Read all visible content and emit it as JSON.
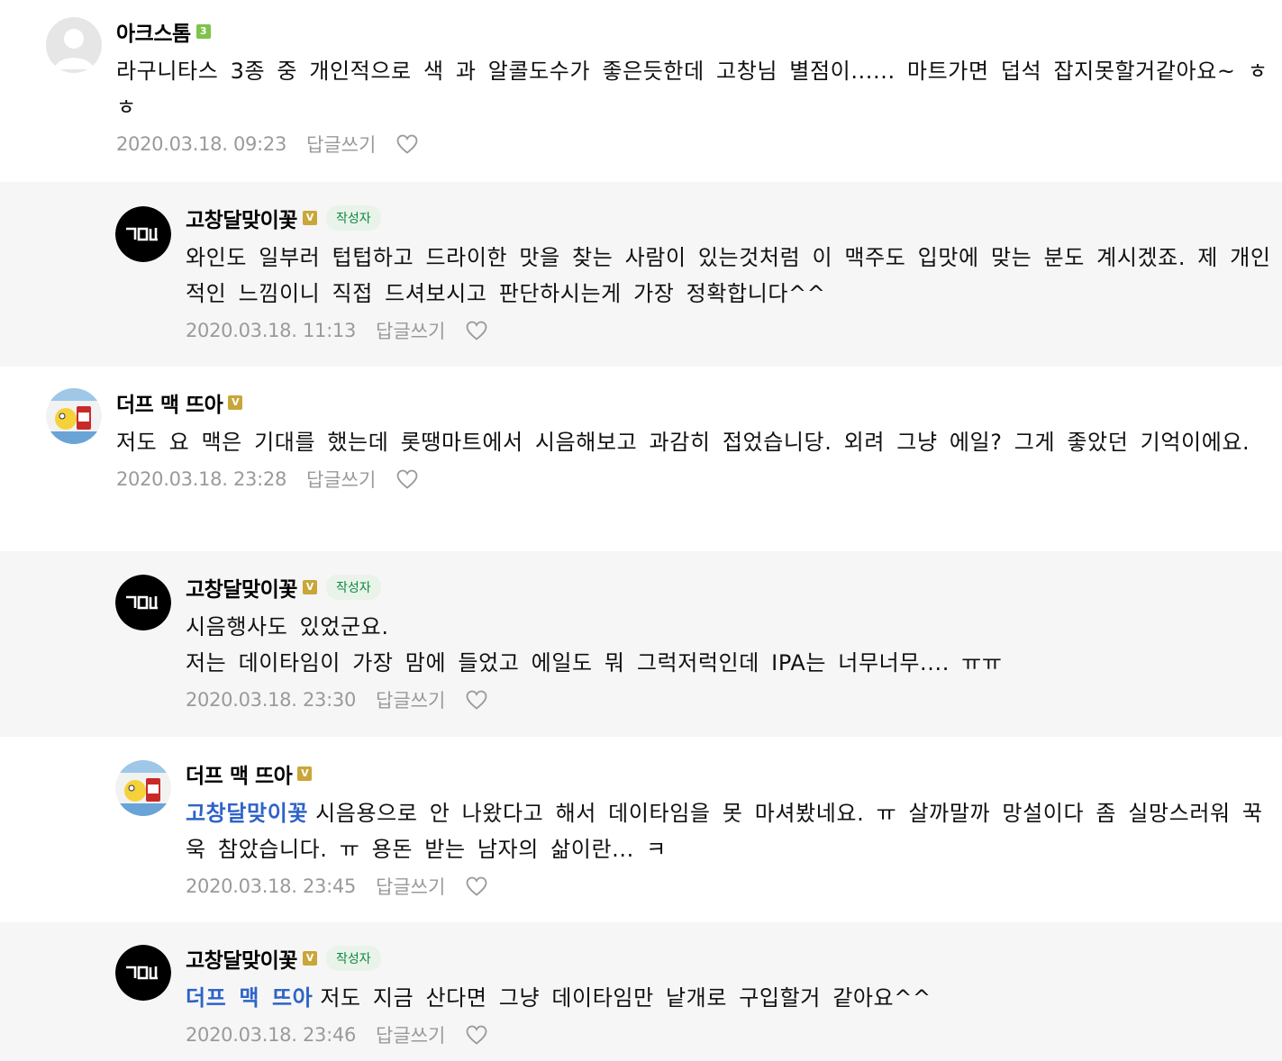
{
  "ui": {
    "reply_label": "답글쓰기",
    "author_tag": "작성자"
  },
  "comments": [
    {
      "type": "comment",
      "nickname": "아크스톰",
      "badge": "3",
      "avatar": "default-avatar",
      "text": "라구니타스 3종 중 개인적으로 색 과 알콜도수가 좋은듯한데 고창님 별점이...... 마트가면 덥석 잡지못할거같아요~ ㅎㅎ",
      "date": "2020.03.18. 09:23"
    },
    {
      "type": "reply",
      "nickname": "고창달맞이꽃",
      "badge": "V",
      "is_author": true,
      "avatar": "gdl-logo-avatar",
      "text": "와인도 일부러 텁텁하고 드라이한 맛을 찾는 사람이 있는것처럼 이 맥주도 입맛에 맞는 분도 계시겠죠. 제 개인적인 느낌이니 직접 드셔보시고 판단하시는게 가장 정확합니다^^",
      "date": "2020.03.18. 11:13"
    },
    {
      "type": "comment",
      "nickname": "더프 맥 뜨아",
      "badge": "V",
      "avatar": "cartoon-avatar",
      "text": "저도 요 맥은 기대를 했는데 롯땡마트에서 시음해보고 과감히 접었습니당. 외려 그냥 에일? 그게 좋았던 기억이에요.",
      "date": "2020.03.18. 23:28"
    },
    {
      "type": "reply",
      "nickname": "고창달맞이꽃",
      "badge": "V",
      "is_author": true,
      "avatar": "gdl-logo-avatar",
      "text_lines": [
        "시음행사도 있었군요.",
        "저는 데이타임이 가장 맘에 들었고 에일도 뭐 그럭저럭인데 IPA는 너무너무.... ㅠㅠ"
      ],
      "date": "2020.03.18. 23:30"
    },
    {
      "type": "reply-white",
      "nickname": "더프 맥 뜨아",
      "badge": "V",
      "avatar": "cartoon-avatar",
      "mention": "고창달맞이꽃",
      "text": "시음용으로 안 나왔다고 해서 데이타임을 못 마셔봤네요. ㅠ 살까말까 망설이다 좀 실망스러워 꾹욱 참았습니다. ㅠ 용돈 받는 남자의 삶이란... ㅋ",
      "date": "2020.03.18. 23:45"
    },
    {
      "type": "reply",
      "nickname": "고창달맞이꽃",
      "badge": "V",
      "is_author": true,
      "avatar": "gdl-logo-avatar",
      "mention": "더프 맥 뜨아",
      "text": "저도 지금 산다면 그냥 데이타임만 낱개로 구입할거 같아요^^",
      "date": "2020.03.18. 23:46"
    }
  ]
}
